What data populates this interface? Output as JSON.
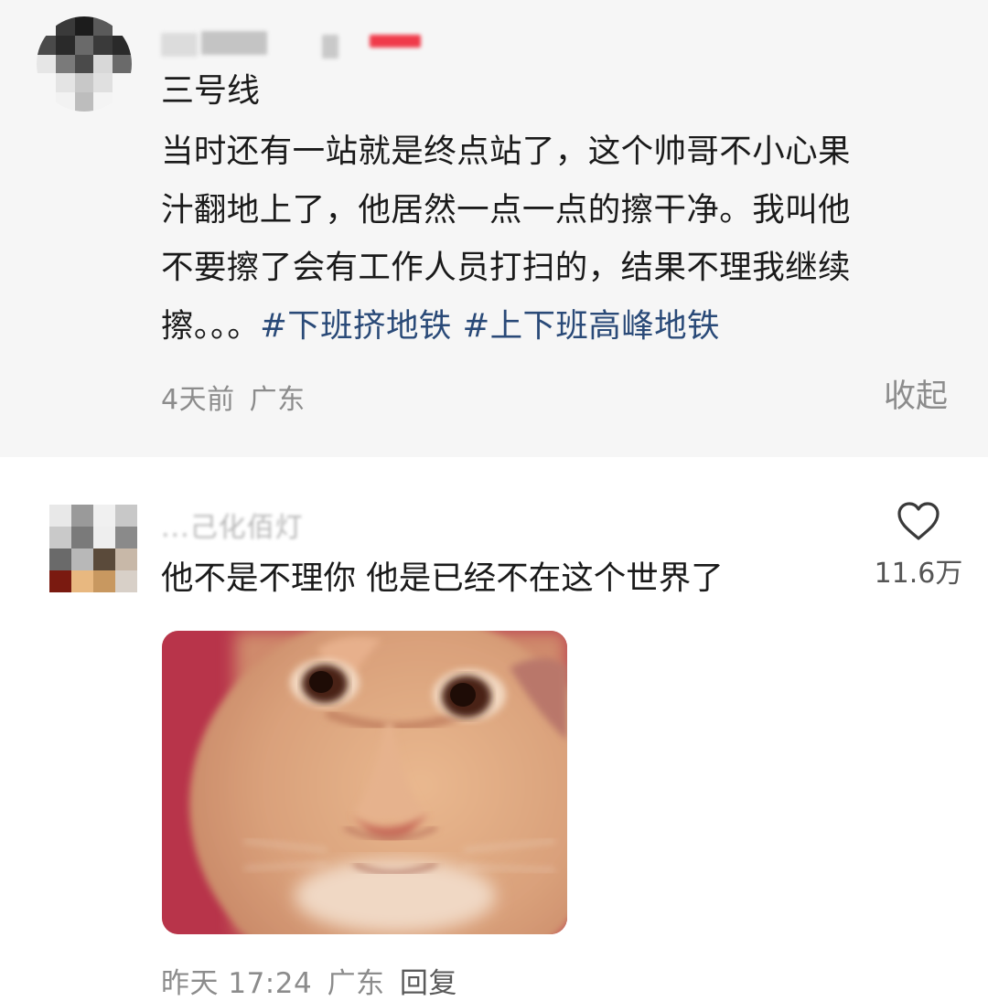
{
  "post": {
    "author_name_text": "",
    "title": "三号线",
    "body_lines": [
      "当时还有一站就是终点站了，这个帅哥不小心果",
      "汁翻地上了，他居然一点一点的擦干净。我叫他",
      "不要擦了会有工作人员打扫的，结果不理我继续"
    ],
    "body_last_prefix": "擦。。。",
    "hashtags": [
      "#下班挤地铁",
      "#上下班高峰地铁"
    ],
    "time": "4天前",
    "location": "广东",
    "collapse_label": "收起"
  },
  "comment": {
    "author_name": "...己化佰灯",
    "text": "他不是不理你 他是已经不在这个世界了",
    "like_count": "11.6万",
    "like_icon": "heart-outline-icon",
    "time": "昨天 17:24",
    "location": "广东",
    "reply_label": "回复",
    "image_subject": "cat-meme"
  },
  "colors": {
    "hashtag": "#2a4a78",
    "meta_text": "#8c8c8c",
    "post_background": "#f6f6f6"
  }
}
